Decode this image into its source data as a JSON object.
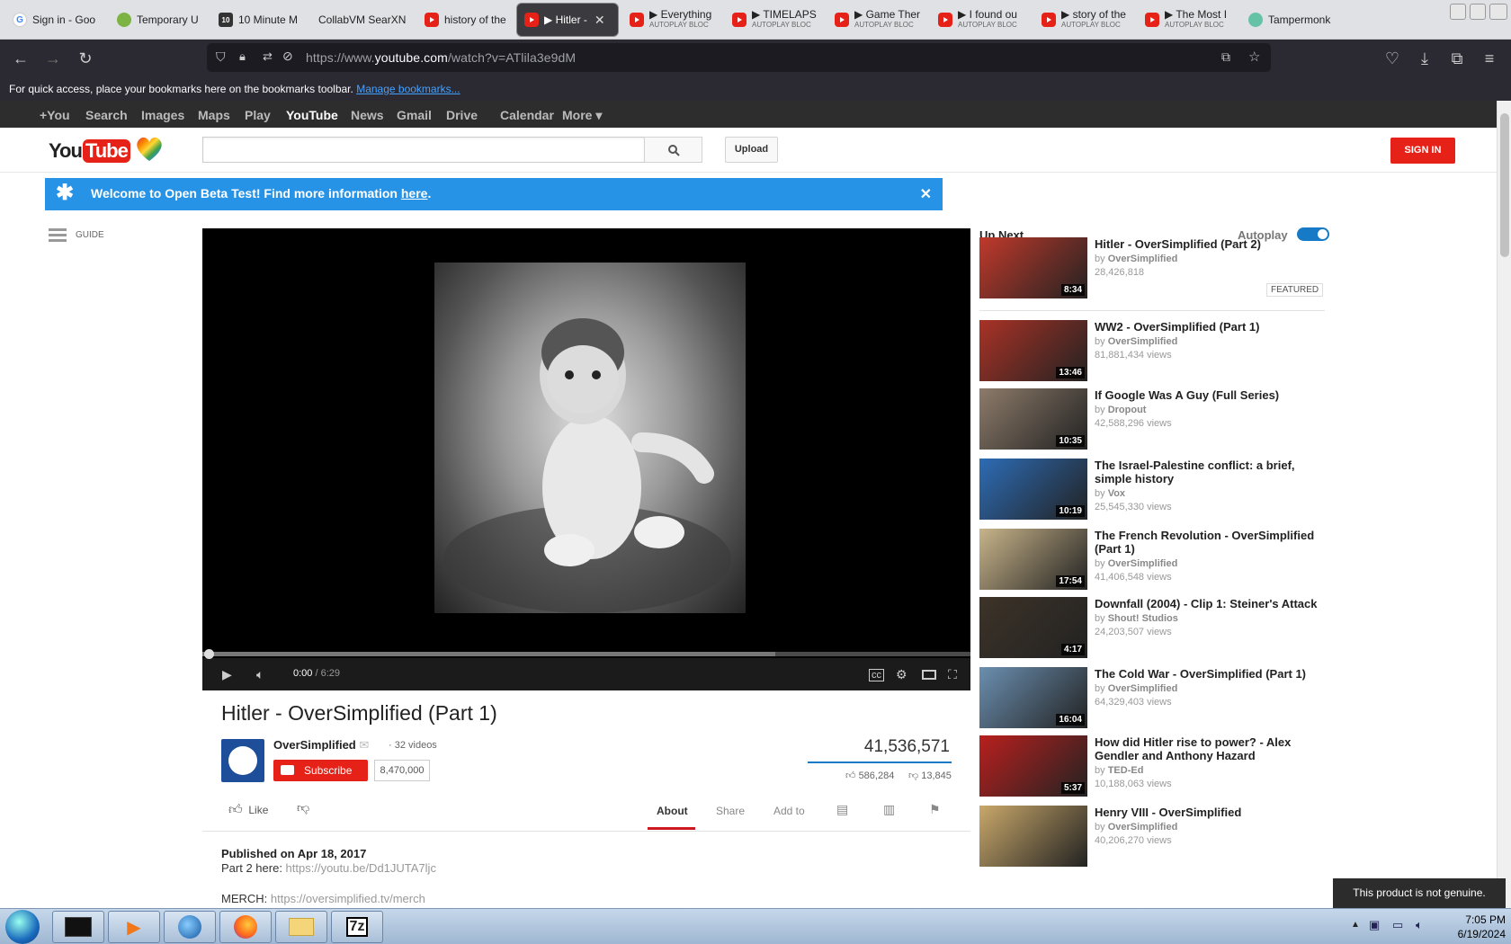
{
  "browser": {
    "tabs": [
      {
        "label": "Sign in - Goo",
        "sub": "",
        "icon": "google-icon"
      },
      {
        "label": "Temporary U",
        "sub": "",
        "icon": "globe-icon"
      },
      {
        "label": "10 Minute M",
        "sub": "",
        "icon": "ten-minute-icon"
      },
      {
        "label": "CollabVM SearXN",
        "sub": "",
        "icon": ""
      },
      {
        "label": "history of the",
        "sub": "",
        "icon": "youtube-icon"
      },
      {
        "label": "▶ Hitler -",
        "sub": "",
        "icon": "youtube-icon"
      },
      {
        "label": "▶ Everything",
        "sub": "AUTOPLAY BLOC",
        "icon": "youtube-icon"
      },
      {
        "label": "▶ TIMELAPS",
        "sub": "AUTOPLAY BLOC",
        "icon": "youtube-icon"
      },
      {
        "label": "▶ Game Ther",
        "sub": "AUTOPLAY BLOC",
        "icon": "youtube-icon"
      },
      {
        "label": "▶ I found ou",
        "sub": "AUTOPLAY BLOC",
        "icon": "youtube-icon"
      },
      {
        "label": "▶ story of the",
        "sub": "AUTOPLAY BLOC",
        "icon": "youtube-icon"
      },
      {
        "label": "▶ The Most I",
        "sub": "AUTOPLAY BLOC",
        "icon": "youtube-icon"
      },
      {
        "label": "Tampermonk",
        "sub": "",
        "icon": "tampermonkey-icon"
      }
    ],
    "url_prefix": "https://www.",
    "url_host": "youtube.com",
    "url_path": "/watch?v=ATlila3e9dM",
    "bookmarks_hint": "For quick access, place your bookmarks here on the bookmarks toolbar.",
    "bookmarks_link": "Manage bookmarks..."
  },
  "gbar": {
    "items": [
      "+You",
      "Search",
      "Images",
      "Maps",
      "Play",
      "YouTube",
      "News",
      "Gmail",
      "Drive",
      "Calendar",
      "More ▾"
    ],
    "active": "YouTube"
  },
  "masthead": {
    "logo_you": "You",
    "logo_tube": "Tube",
    "search_placeholder": "",
    "upload": "Upload",
    "signin": "SIGN IN"
  },
  "banner": {
    "text": "Welcome to Open Beta Test! Find more information ",
    "link": "here",
    "tail": "."
  },
  "guide": "GUIDE",
  "player": {
    "time_current": "0:00",
    "time_duration": " / 6:29",
    "buffered_fraction": 0.746
  },
  "video": {
    "title": "Hitler - OverSimplified (Part 1)",
    "channel": "OverSimplified",
    "video_count": "· 32 videos",
    "subscribe": "Subscribe",
    "subscribers": "8,470,000",
    "views": "41,536,571",
    "likes": "586,284",
    "dislikes": "13,845",
    "like_label": "Like",
    "tabs": [
      "About",
      "Share",
      "Add to"
    ],
    "published": "Published on Apr 18, 2017",
    "desc_part2_label": "Part 2 here: ",
    "desc_part2_link": "https://youtu.be/Dd1JUTA7ljc",
    "desc_merch_label": "MERCH: ",
    "desc_merch_link": "https://oversimplified.tv/merch"
  },
  "sidebar": {
    "up_next": "Up Next",
    "autoplay": "Autoplay",
    "autoplay_on": true,
    "featured": "FEATURED",
    "items": [
      {
        "title": "Hitler - OverSimplified (Part 2)",
        "by_prefix": "by ",
        "channel": "OverSimplified",
        "views": "28,426,818",
        "duration": "8:34",
        "thumb": "#c0392b"
      },
      {
        "title": "WW2 - OverSimplified (Part 1)",
        "by_prefix": "by ",
        "channel": "OverSimplified",
        "views": "81,881,434 views",
        "duration": "13:46",
        "thumb": "#a93226"
      },
      {
        "title": "If Google Was A Guy (Full Series)",
        "by_prefix": "by ",
        "channel": "Dropout",
        "views": "42,588,296 views",
        "duration": "10:35",
        "thumb": "#8d7b6a"
      },
      {
        "title": "The Israel-Palestine conflict: a brief, simple history",
        "by_prefix": "by ",
        "channel": "Vox",
        "views": "25,545,330 views",
        "duration": "10:19",
        "thumb": "#2d6cb5"
      },
      {
        "title": "The French Revolution - OverSimplified (Part 1)",
        "by_prefix": "by ",
        "channel": "OverSimplified",
        "views": "41,406,548 views",
        "duration": "17:54",
        "thumb": "#c8b48a"
      },
      {
        "title": "Downfall (2004) - Clip 1: Steiner's Attack",
        "by_prefix": "by ",
        "channel": "Shout! Studios",
        "views": "24,203,507 views",
        "duration": "4:17",
        "thumb": "#3d3328"
      },
      {
        "title": "The Cold War - OverSimplified (Part 1)",
        "by_prefix": "by ",
        "channel": "OverSimplified",
        "views": "64,329,403 views",
        "duration": "16:04",
        "thumb": "#6b8fb0"
      },
      {
        "title": "How did Hitler rise to power? - Alex Gendler and Anthony Hazard",
        "by_prefix": "by ",
        "channel": "TED-Ed",
        "views": "10,188,063 views",
        "duration": "5:37",
        "thumb": "#b8201e"
      },
      {
        "title": "Henry VIII - OverSimplified",
        "by_prefix": "by ",
        "channel": "OverSimplified",
        "views": "40,206,270 views",
        "duration": "",
        "thumb": "#c9a86a"
      }
    ]
  },
  "taskbar": {
    "time": "7:05 PM",
    "date": "6/19/2024",
    "toast": "This product is not genuine."
  }
}
